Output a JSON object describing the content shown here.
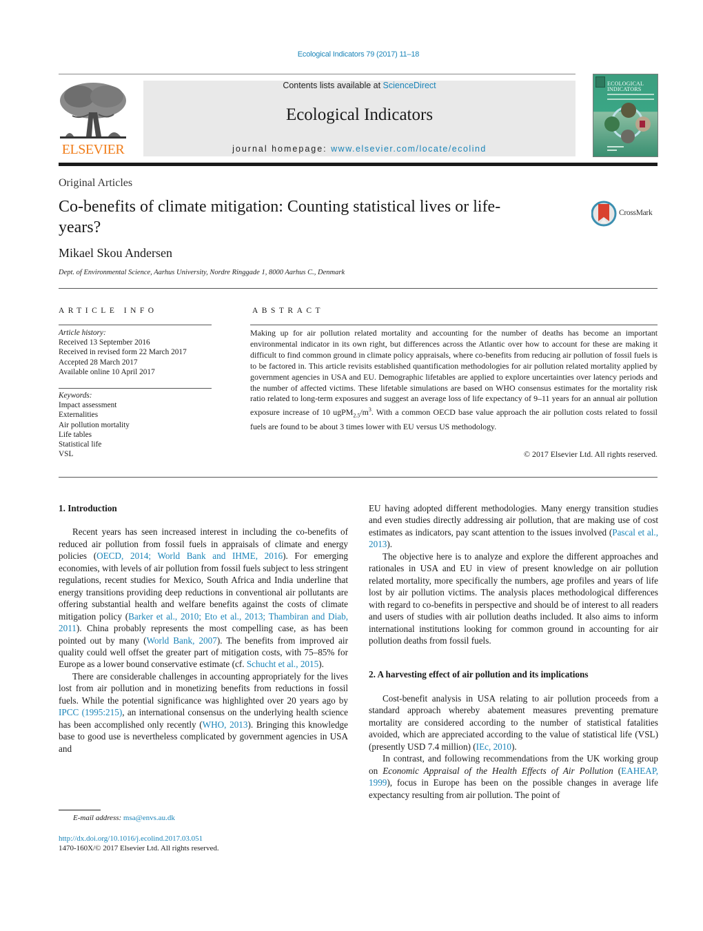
{
  "header": {
    "citation": "Ecological Indicators 79 (2017) 11–18",
    "contents_prefix": "Contents lists available at ",
    "contents_link": "ScienceDirect",
    "journal_name": "Ecological Indicators",
    "homepage_prefix": "journal homepage: ",
    "homepage_link": "www.elsevier.com/locate/ecolind",
    "publisher_logo_text": "ELSEVIER",
    "cover_title_line1": "ECOLOGICAL",
    "cover_title_line2": "INDICATORS",
    "crossmark_label": "CrossMark",
    "colors": {
      "link": "#1a84b8",
      "elsevier_orange": "#f07d1a",
      "header_box": "#e9e9e9",
      "cover_green": "#3aa685",
      "crossmark_red": "#d9412f"
    }
  },
  "article": {
    "type": "Original Articles",
    "title": "Co-benefits of climate mitigation: Counting statistical lives or life-years?",
    "author": "Mikael Skou Andersen",
    "affiliation": "Dept. of Environmental Science, Aarhus University, Nordre Ringgade 1, 8000 Aarhus C., Denmark"
  },
  "article_info": {
    "heading": "ARTICLE INFO",
    "history_label": "Article history:",
    "history": [
      "Received 13 September 2016",
      "Received in revised form 22 March 2017",
      "Accepted 28 March 2017",
      "Available online 10 April 2017"
    ],
    "keywords_label": "Keywords:",
    "keywords": [
      "Impact assessment",
      "Externalities",
      "Air pollution mortality",
      "Life tables",
      "Statistical life",
      "VSL"
    ]
  },
  "abstract": {
    "heading": "ABSTRACT",
    "text_part1": "Making up for air pollution related mortality and accounting for the number of deaths has become an important environmental indicator in its own right, but differences across the Atlantic over how to account for these are making it difficult to find common ground in climate policy appraisals, where co-benefits from reducing air pollution of fossil fuels is to be factored in. This article revisits established quantification methodologies for air pollution related mortality applied by government agencies in USA and EU. Demographic lifetables are applied to explore uncertainties over latency periods and the number of affected victims. These lifetable simulations are based on WHO consensus estimates for the mortality risk ratio related to long-term exposures and suggest an average loss of life expectancy of 9–11 years for an annual air pollution exposure increase of 10 ugPM",
    "sub": "2.5",
    "text_part2": "/m",
    "sup": "3",
    "text_part3": ". With a common OECD base value approach the air pollution costs related to fossil fuels are found to be about 3 times lower with EU versus US methodology.",
    "copyright": "© 2017 Elsevier Ltd. All rights reserved."
  },
  "body": {
    "sec1_heading": "1.  Introduction",
    "p1": [
      {
        "t": "Recent years has seen increased interest in including the co-benefits of reduced air pollution from fossil fuels in appraisals of climate and energy policies ("
      },
      {
        "t": "OECD, 2014; World Bank and IHME, 2016",
        "link": true
      },
      {
        "t": "). For emerging economies, with levels of air pollution from fossil fuels subject to less stringent regulations, recent studies for Mexico, South Africa and India underline that energy transitions providing deep reductions in conventional air pollutants are offering substantial health and welfare benefits against the costs of climate mitigation policy ("
      },
      {
        "t": "Barker et al., 2010; Eto et al., 2013; Thambiran and Diab, 2011",
        "link": true
      },
      {
        "t": "). China probably represents the most compelling case, as has been pointed out by many ("
      },
      {
        "t": "World Bank, 2007",
        "link": true
      },
      {
        "t": "). The benefits from improved air quality could well offset the greater part of mitigation costs, with 75–85% for Europe as a lower bound conservative estimate (cf. "
      },
      {
        "t": "Schucht et al., 2015",
        "link": true
      },
      {
        "t": ")."
      }
    ],
    "p2": [
      {
        "t": "There are considerable challenges in accounting appropriately for the lives lost from air pollution and in monetizing benefits from reductions in fossil fuels. While the potential significance was highlighted over 20 years ago by "
      },
      {
        "t": "IPCC (1995:215)",
        "link": true
      },
      {
        "t": ", an international consensus on the underlying health science has been accomplished only recently ("
      },
      {
        "t": "WHO, 2013",
        "link": true
      },
      {
        "t": "). Bringing this knowledge base to good use is nevertheless complicated by government agencies in USA and EU having adopted different methodologies. Many energy transition studies and even studies directly addressing air pollution, that are making use of cost estimates as indicators, pay scant attention to the issues involved ("
      },
      {
        "t": "Pascal et al., 2013",
        "link": true
      },
      {
        "t": ")."
      }
    ],
    "p3": [
      {
        "t": "The objective here is to analyze and explore the different approaches and rationales in USA and EU in view of present knowledge on air pollution related mortality, more specifically the numbers, age profiles and years of life lost by air pollution victims. The analysis places methodological differences with regard to co-benefits in perspective and should be of interest to all readers and users of studies with air pollution deaths included. It also aims to inform international institutions looking for common ground in accounting for air pollution deaths from fossil fuels."
      }
    ],
    "sec2_heading": "2.  A harvesting effect of air pollution and its implications",
    "p4": [
      {
        "t": "Cost-benefit analysis in USA relating to air pollution proceeds from a standard approach whereby abatement measures preventing premature mortality are considered according to the number of statistical fatalities avoided, which are appreciated according to the value of statistical life (VSL) (presently USD 7.4 million) ("
      },
      {
        "t": "IEc, 2010",
        "link": true
      },
      {
        "t": ")."
      }
    ],
    "p5": [
      {
        "t": "In contrast, and following recommendations from the UK working group on "
      },
      {
        "t": "Economic Appraisal of the Health Effects of Air Pollution",
        "italic": true
      },
      {
        "t": " ("
      },
      {
        "t": "EAHEAP, 1999",
        "link": true
      },
      {
        "t": "), focus in Europe has been on the possible changes in average life expectancy resulting from air pollution. The point of"
      }
    ]
  },
  "footer": {
    "email_label": "E-mail address: ",
    "email": "msa@envs.au.dk",
    "doi": "http://dx.doi.org/10.1016/j.ecolind.2017.03.051",
    "issn": "1470-160X/© 2017 Elsevier Ltd. All rights reserved."
  }
}
